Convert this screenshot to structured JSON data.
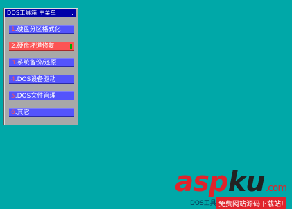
{
  "window": {
    "title": "DOS工具箱 主菜单",
    "title_dot": "."
  },
  "menu": {
    "items": [
      {
        "num": "1",
        "label": ".硬盘分区格式化",
        "selected": false
      },
      {
        "num": "2",
        "label": ".硬盘坏道修复",
        "selected": true
      },
      {
        "num": "3",
        "label": ".系统备份/还原",
        "selected": false
      },
      {
        "num": "4",
        "label": ".DOS设备驱动",
        "selected": false
      },
      {
        "num": "5",
        "label": ".DOS文件管理",
        "selected": false
      },
      {
        "num": "6",
        "label": ".其它",
        "selected": false
      }
    ]
  },
  "watermark": {
    "logo_red": "asp",
    "logo_black": "ku",
    "logo_com": ".com",
    "caption": "免费网站源码下载站!",
    "dos_text": "DOS工具箱"
  },
  "colors": {
    "desktop": "#00A8A8",
    "title_bar": "#0000A8",
    "menu_item": "#5454FC",
    "menu_item_selected": "#FC5454",
    "window": "#A8A8A8"
  }
}
